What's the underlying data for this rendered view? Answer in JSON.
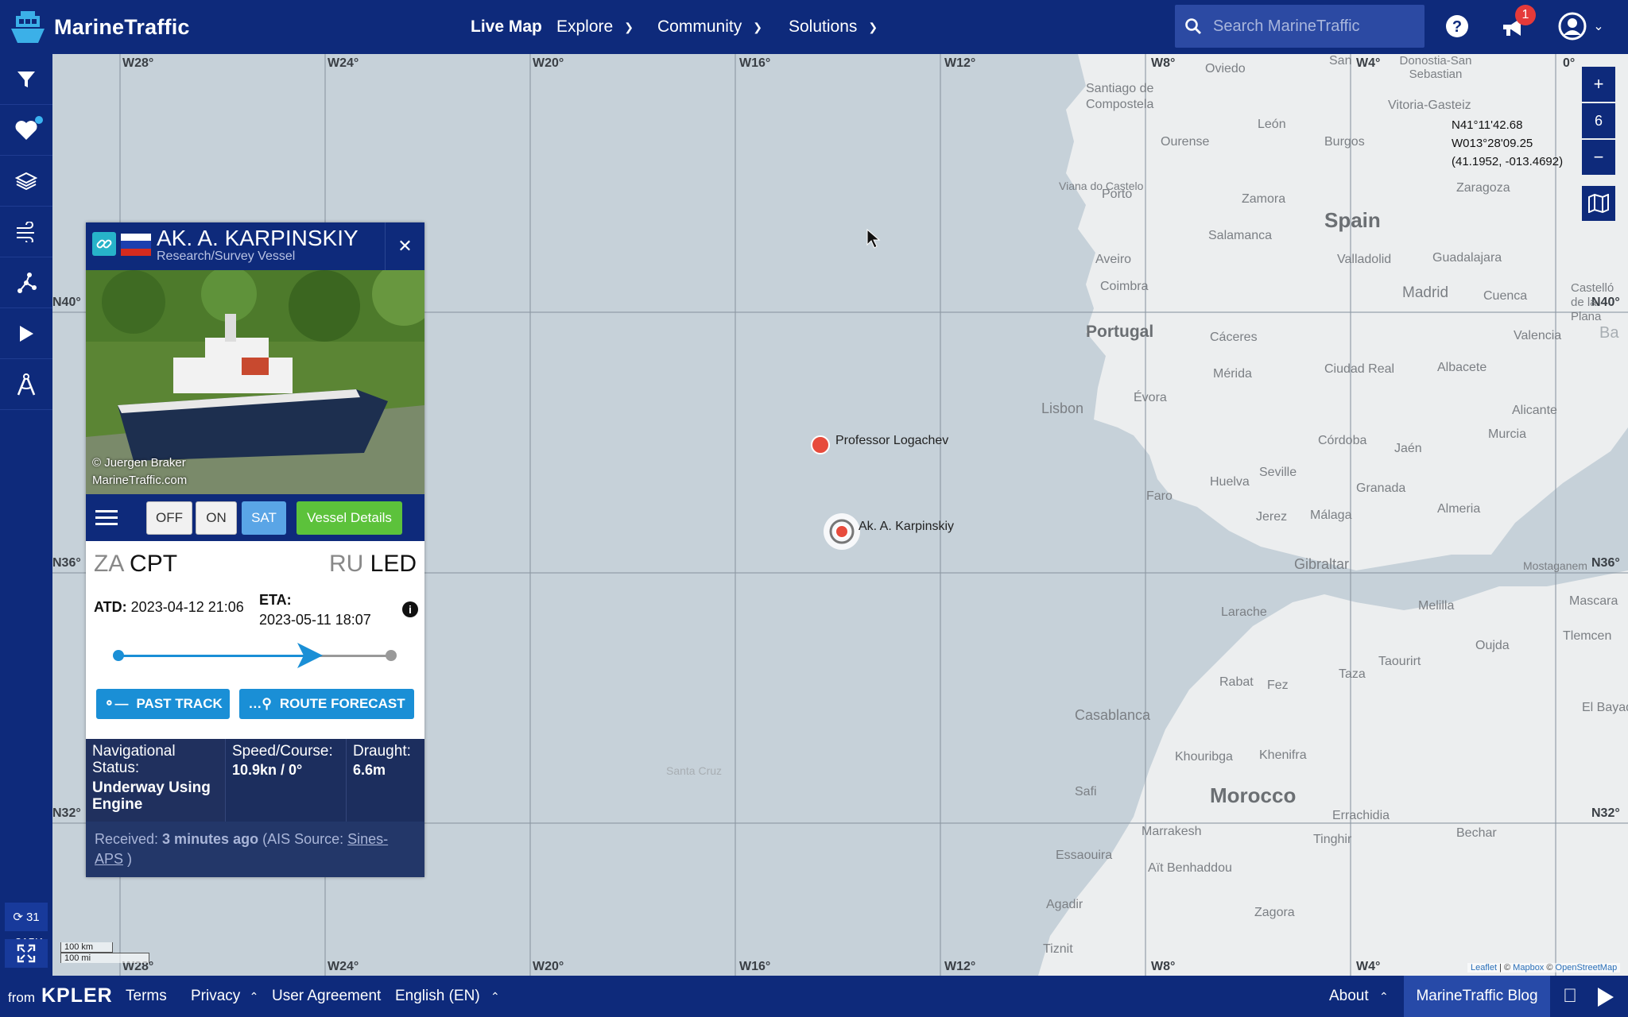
{
  "brand": {
    "name": "MarineTraffic"
  },
  "nav": {
    "live_map": "Live Map",
    "explore": "Explore",
    "community": "Community",
    "solutions": "Solutions"
  },
  "search": {
    "placeholder": "Search MarineTraffic"
  },
  "notifications": {
    "count": "1"
  },
  "map": {
    "lon_labels_top": [
      "W28°",
      "W24°",
      "W20°",
      "W16°",
      "W12°",
      "W8°",
      "W4°",
      "0°"
    ],
    "lon_labels_bottom": [
      "W28°",
      "W24°",
      "W20°",
      "W16°",
      "W12°",
      "W8°",
      "W4°"
    ],
    "lat_labels": [
      "N40°",
      "N36°",
      "N32°"
    ],
    "lat_labels_right": [
      "N40°",
      "N36°",
      "N32°"
    ],
    "zoom_level": "6",
    "cursor_coords": {
      "lat": "N41°11'42.68",
      "lon": "W013°28'09.25",
      "decimal": "(41.1952, -013.4692)"
    },
    "countries": {
      "spain": "Spain",
      "portugal": "Portugal",
      "morocco": "Morocco"
    },
    "places": [
      "Oviedo",
      "San",
      "Donostia-San Sebastian",
      "Santiago de Compostela",
      "Vitoria-Gasteiz",
      "León",
      "Burgos",
      "Ourense",
      "Viana do Castelo",
      "Zamora",
      "Zaragoza",
      "Porto",
      "Salamanca",
      "Aveiro",
      "Valladolid",
      "Guadalajara",
      "Coimbra",
      "Madrid",
      "Cuenca",
      "Castelló de la Plana",
      "Cáceres",
      "Valencia",
      "Mérida",
      "Ciudad Real",
      "Albacete",
      "Lisbon",
      "Évora",
      "Alicante",
      "Murcia",
      "Córdoba",
      "Jaén",
      "Huelva",
      "Seville",
      "Granada",
      "Faro",
      "Jerez",
      "Málaga",
      "Almeria",
      "Gibraltar",
      "Mostaganem",
      "Larache",
      "Melilla",
      "Mascara",
      "Tlemcen",
      "Oujda",
      "Taourirt",
      "Taza",
      "Rabat",
      "Fez",
      "Casablanca",
      "Khouribga",
      "Khenifra",
      "El Bayadh",
      "Errachidia",
      "Safi",
      "Marrakesh",
      "Bechar",
      "Essaouira",
      "Tinghir",
      "Aït Benhaddou",
      "Agadir",
      "Zagora",
      "Tiznit",
      "Santa Cruz",
      "Ba"
    ],
    "vessels": [
      {
        "name": "Professor Logachev"
      },
      {
        "name": "Ak. A. Karpinskiy"
      }
    ],
    "scale": {
      "km": "100 km",
      "mi": "100 mi"
    },
    "attribution": {
      "leaflet": "Leaflet",
      "sep": " | © ",
      "mapbox": "Mapbox",
      "osm": "OpenStreetMap"
    }
  },
  "sidebar": {
    "vessel_count": "315K",
    "refresh_count": "31"
  },
  "vessel": {
    "name": "AK. A. KARPINSKIY",
    "type": "Research/Survey Vessel",
    "photo_credit_1": "© Juergen Braker",
    "photo_credit_2": "MarineTraffic.com",
    "buttons": {
      "off": "OFF",
      "on": "ON",
      "sat": "SAT",
      "details": "Vessel Details"
    },
    "from_country": "ZA",
    "from_port": "CPT",
    "to_country": "RU",
    "to_port": "LED",
    "atd_label": "ATD:",
    "atd_value": "2023-04-12 21:06",
    "eta_label": "ETA:",
    "eta_value": "2023-05-11 18:07",
    "progress": 0.7,
    "past_track": "PAST TRACK",
    "route_forecast": "ROUTE FORECAST",
    "nav_status_label": "Navigational Status:",
    "nav_status_value": "Underway Using Engine",
    "speed_label": "Speed/Course:",
    "speed_value": "10.9kn / 0°",
    "draught_label": "Draught:",
    "draught_value": "6.6m",
    "received_prefix": "Received: ",
    "received_time": "3 minutes ago",
    "ais_prefix": " (AIS Source: ",
    "ais_source": "Sines-APS",
    "ais_suffix": " )"
  },
  "footer": {
    "from": "from",
    "kpler": "KPLER",
    "terms": "Terms",
    "privacy": "Privacy",
    "user_agreement": "User Agreement",
    "language": "English (EN)",
    "about": "About",
    "blog": "MarineTraffic Blog"
  },
  "colors": {
    "navy": "#0e2a7b",
    "accent": "#1a8fd6",
    "green": "#5cc23b",
    "sat": "#5aa5e6"
  }
}
